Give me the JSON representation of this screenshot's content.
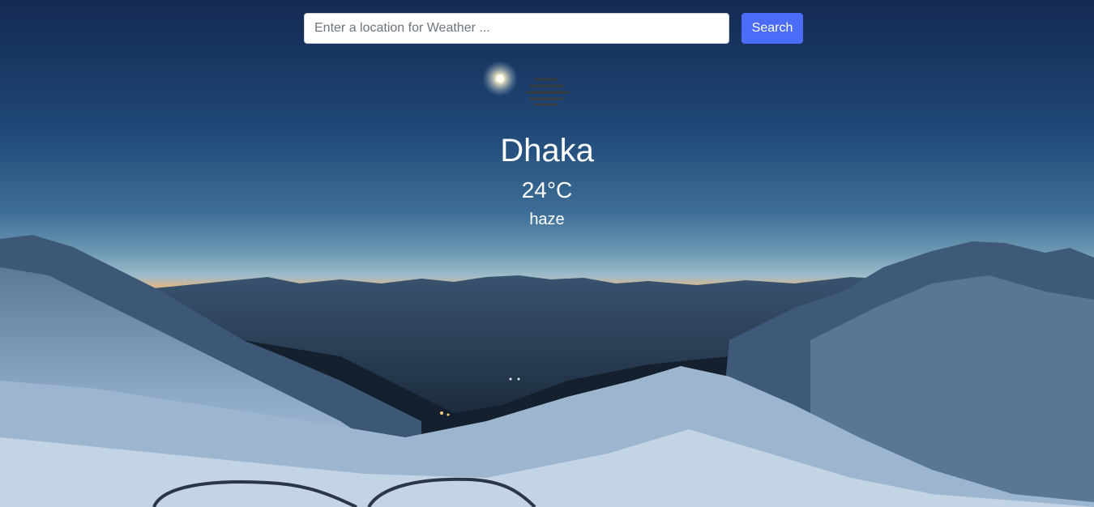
{
  "search": {
    "placeholder": "Enter a location for Weather ...",
    "value": "",
    "button_label": "Search"
  },
  "weather": {
    "icon": "haze-icon",
    "city": "Dhaka",
    "temperature": "24°C",
    "description": "haze"
  },
  "colors": {
    "accent": "#4b6cf7",
    "text": "#ffffff"
  }
}
